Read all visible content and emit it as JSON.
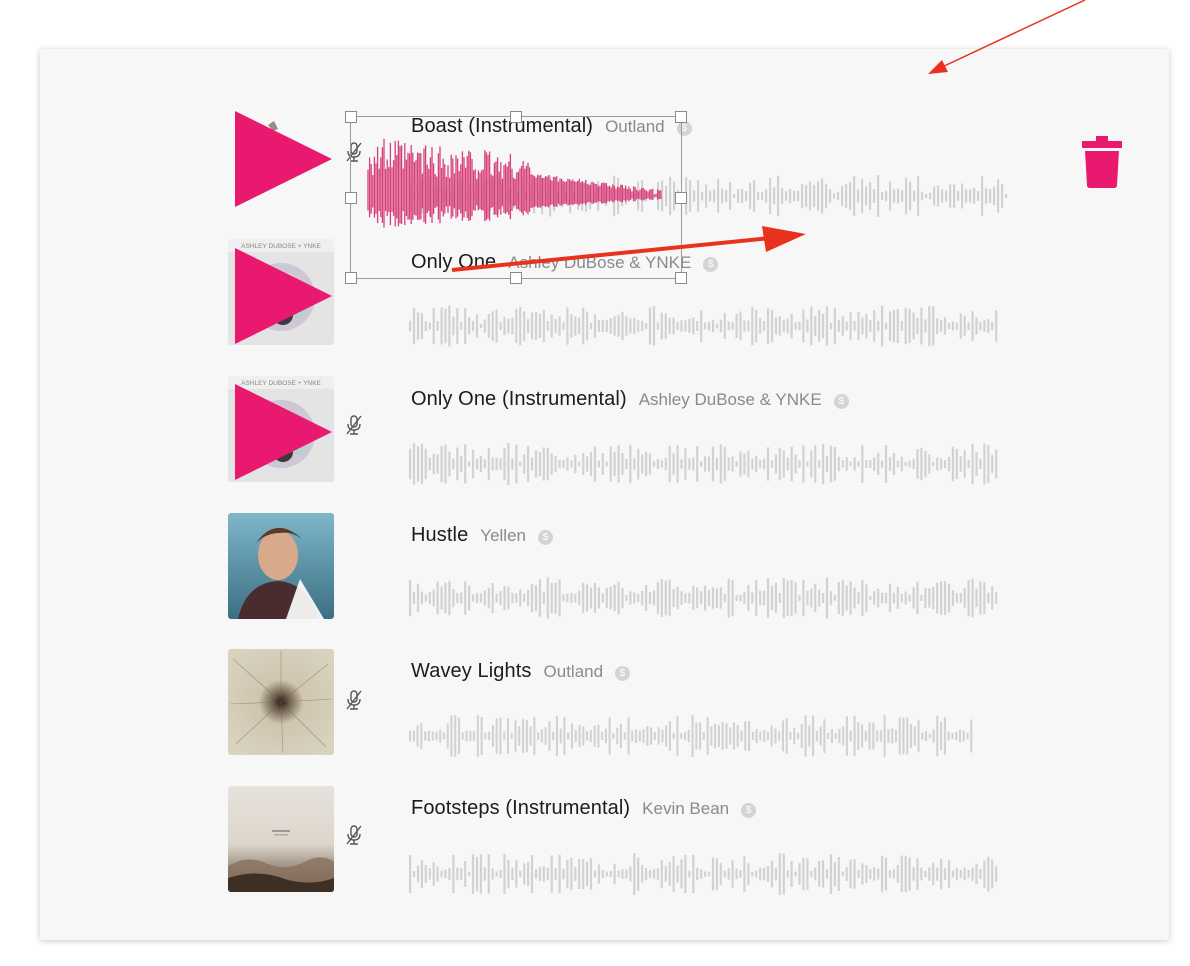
{
  "tracks": [
    {
      "title": "Boast (Instrumental)",
      "artist": "Outland",
      "badge": "$",
      "instrumental": true
    },
    {
      "title": "Only One",
      "artist": "Ashley DuBose & YNKE",
      "badge": "$",
      "instrumental": false
    },
    {
      "title": "Only One (Instrumental)",
      "artist": "Ashley DuBose & YNKE",
      "badge": "$",
      "instrumental": true
    },
    {
      "title": "Hustle",
      "artist": "Yellen",
      "badge": "$",
      "instrumental": false
    },
    {
      "title": "Wavey Lights",
      "artist": "Outland",
      "badge": "$",
      "instrumental": true
    },
    {
      "title": "Footsteps (Instrumental)",
      "artist": "Kevin Bean",
      "badge": "$",
      "instrumental": true
    }
  ],
  "album_art_text": {
    "only_one": "ASHLEY DUBOSE + YNKE"
  },
  "icons": {
    "play": "play-icon",
    "trash": "trash-icon",
    "muted_mic": "mic-off-icon"
  },
  "colors": {
    "accent": "#e8196f",
    "waveform": "#d2d2d2",
    "annotation_arrow": "#e8321e",
    "panel": "#f7f7f7"
  }
}
